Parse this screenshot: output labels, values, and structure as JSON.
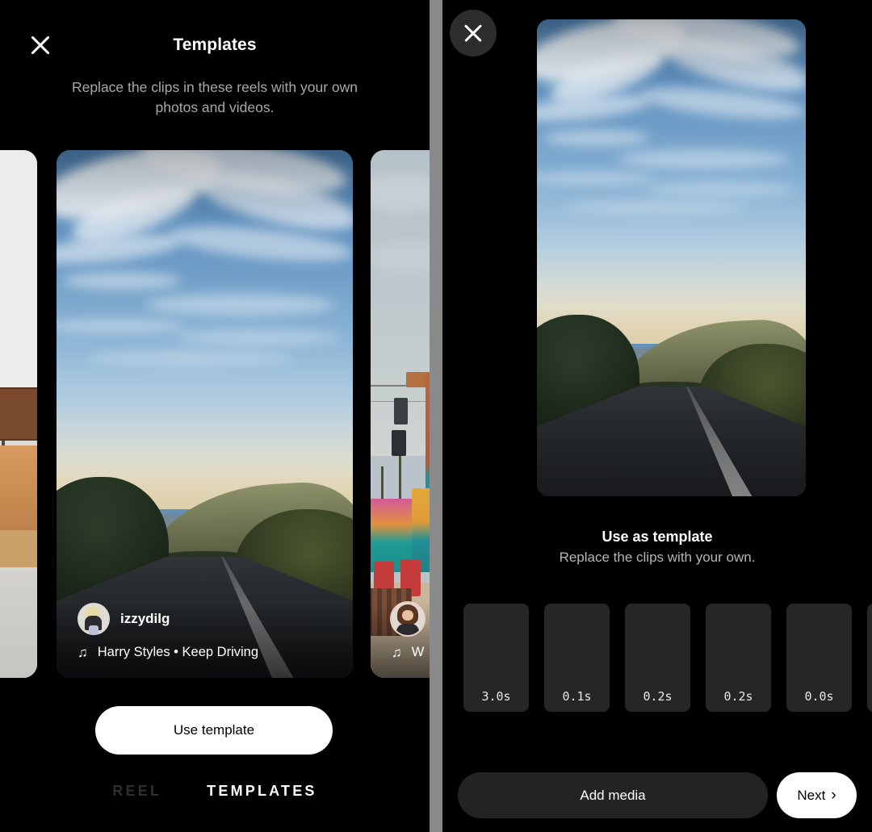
{
  "left_panel": {
    "close_icon": "close-x-icon",
    "title": "Templates",
    "subtitle": "Replace the clips in these reels with your own photos and videos.",
    "cards": [
      {
        "scene": "interior room with brown chair",
        "username": "",
        "music": ""
      },
      {
        "scene": "coastal road with blue sky",
        "username": "izzydilg",
        "music": "Harry Styles • Keep Driving",
        "music_icon": "music-note-icon"
      },
      {
        "scene": "beach boardwalk with chairlift",
        "username": "",
        "music": "W",
        "music_icon": "music-note-icon"
      }
    ],
    "use_template_label": "Use template",
    "tabs": [
      {
        "label": "REEL",
        "active": false
      },
      {
        "label": "TEMPLATES",
        "active": true
      }
    ]
  },
  "right_panel": {
    "close_icon": "close-x-icon",
    "hero_scene": "coastal road with blue sky",
    "title": "Use as template",
    "subtitle": "Replace the clips with your own.",
    "clips": [
      {
        "duration": "3.0s"
      },
      {
        "duration": "0.1s"
      },
      {
        "duration": "0.2s"
      },
      {
        "duration": "0.2s"
      },
      {
        "duration": "0.0s"
      },
      {
        "duration": ""
      }
    ],
    "add_media_label": "Add media",
    "next_label": "Next",
    "next_icon": "chevron-right-icon"
  },
  "colors": {
    "background": "#000000",
    "divider": "#8a8a8a",
    "accent_white": "#ffffff",
    "muted_text": "#a8a8a8",
    "clip_bg": "#262626",
    "add_media_bg": "#232323",
    "tab_inactive": "#2f2f2f"
  }
}
